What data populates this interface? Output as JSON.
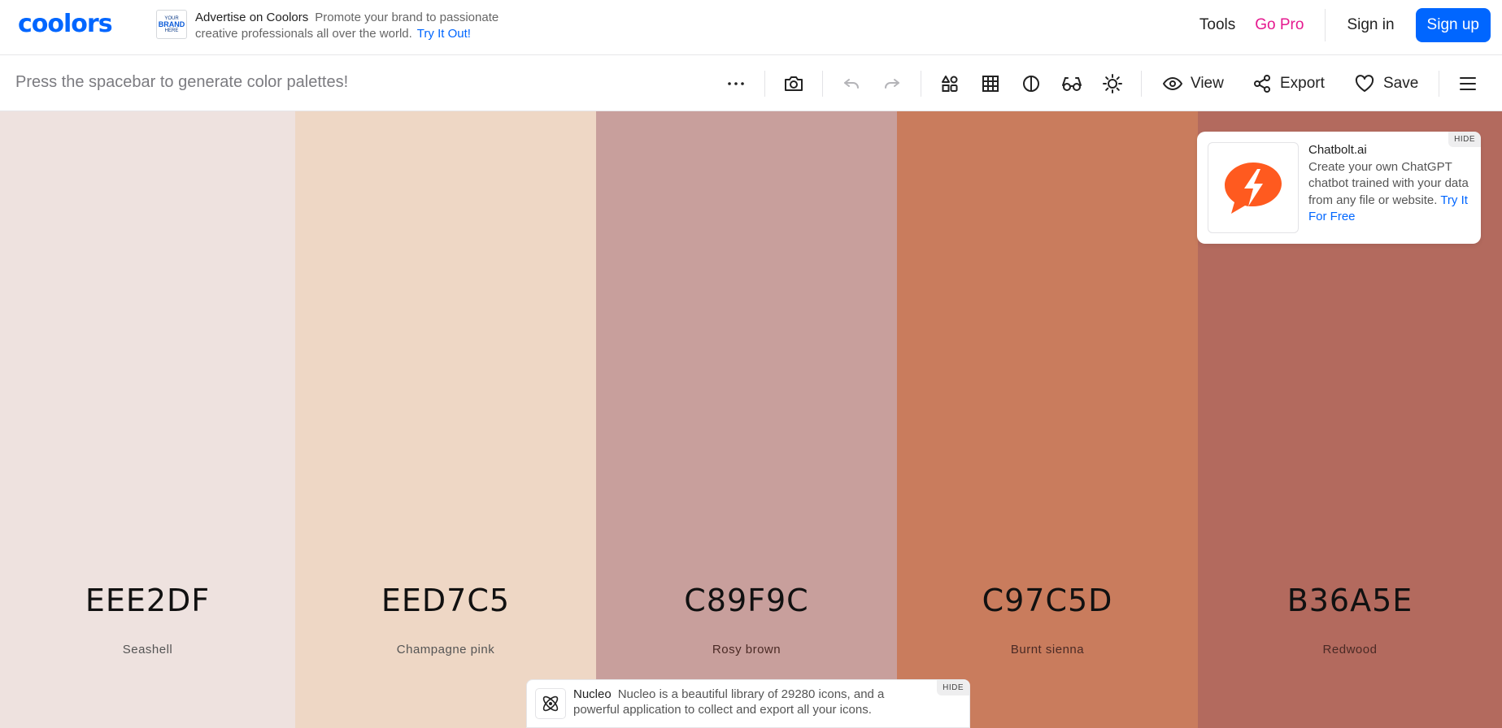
{
  "header": {
    "logo": "coolors",
    "ad": {
      "brand_lines": [
        "YOUR",
        "BRAND",
        "HERE"
      ],
      "title": "Advertise on Coolors",
      "text": "Promote your brand to passionate creative professionals all over the world.",
      "link": "Try It Out!"
    },
    "nav": {
      "tools": "Tools",
      "go_pro": "Go Pro",
      "sign_in": "Sign in",
      "sign_up": "Sign up"
    }
  },
  "toolbar": {
    "hint": "Press the spacebar to generate color palettes!",
    "view_label": "View",
    "export_label": "Export",
    "save_label": "Save"
  },
  "palette": {
    "colors": [
      {
        "hex": "EEE2DF",
        "name": "Seashell",
        "color": "#EEE2DF"
      },
      {
        "hex": "EED7C5",
        "name": "Champagne pink",
        "color": "#EED7C5"
      },
      {
        "hex": "C89F9C",
        "name": "Rosy brown",
        "color": "#C89F9C"
      },
      {
        "hex": "C97C5D",
        "name": "Burnt sienna",
        "color": "#C97C5D"
      },
      {
        "hex": "B36A5E",
        "name": "Redwood",
        "color": "#B36A5E"
      }
    ]
  },
  "side_ad": {
    "title": "Chatbolt.ai",
    "text": "Create your own ChatGPT chatbot trained with your data from any file or website.",
    "link": "Try It For Free",
    "hide": "HIDE",
    "accent": "#FF5A1F"
  },
  "bottom_ad": {
    "title": "Nucleo",
    "text": "Nucleo is a beautiful library of 29280 icons, and a powerful application to collect and export all your icons.",
    "hide": "HIDE"
  }
}
